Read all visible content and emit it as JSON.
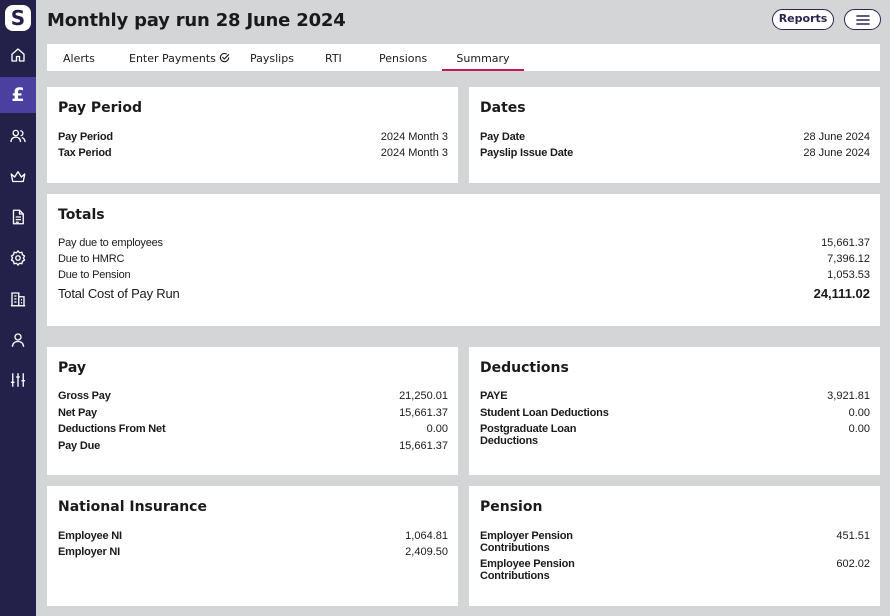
{
  "app": {
    "logo_letter": "S"
  },
  "header": {
    "title": "Monthly pay run 28 June 2024",
    "reports_label": "Reports"
  },
  "tabs": [
    {
      "label": "Alerts"
    },
    {
      "label": "Enter Payments"
    },
    {
      "label": "Payslips"
    },
    {
      "label": "RTI"
    },
    {
      "label": "Pensions"
    },
    {
      "label": "Summary",
      "active": true
    }
  ],
  "sidebar": {
    "items": [
      "home-icon",
      "pound-icon",
      "users-icon",
      "crown-icon",
      "document-icon",
      "gear-icon",
      "building-icon",
      "person-icon",
      "sliders-icon"
    ],
    "active": "pound-icon",
    "pound_glyph": "£"
  },
  "pay_period": {
    "title": "Pay Period",
    "rows": [
      {
        "label": "Pay Period",
        "value": "2024 Month 3"
      },
      {
        "label": "Tax Period",
        "value": "2024 Month 3"
      }
    ]
  },
  "dates": {
    "title": "Dates",
    "rows": [
      {
        "label": "Pay Date",
        "value": "28 June 2024"
      },
      {
        "label": "Payslip Issue Date",
        "value": "28 June 2024"
      }
    ]
  },
  "totals": {
    "title": "Totals",
    "rows": [
      {
        "label": "Pay due to employees",
        "value": "15,661.37"
      },
      {
        "label": "Due to HMRC",
        "value": "7,396.12"
      },
      {
        "label": "Due to Pension",
        "value": "1,053.53"
      },
      {
        "label": "Total Cost of Pay Run",
        "value": "24,111.02"
      }
    ]
  },
  "pay": {
    "title": "Pay",
    "rows": [
      {
        "label": "Gross Pay",
        "value": "21,250.01"
      },
      {
        "label": "Net Pay",
        "value": "15,661.37"
      },
      {
        "label": "Deductions From Net",
        "value": "0.00"
      },
      {
        "label": "Pay Due",
        "value": "15,661.37"
      }
    ]
  },
  "deductions": {
    "title": "Deductions",
    "rows": [
      {
        "label": "PAYE",
        "value": "3,921.81"
      },
      {
        "label": "Student Loan Deductions",
        "value": "0.00"
      },
      {
        "label": "Postgraduate Loan Deductions",
        "value": "0.00"
      }
    ]
  },
  "national_insurance": {
    "title": "National Insurance",
    "rows": [
      {
        "label": "Employee NI",
        "value": "1,064.81"
      },
      {
        "label": "Employer NI",
        "value": "2,409.50"
      }
    ]
  },
  "pension": {
    "title": "Pension",
    "rows": [
      {
        "label": "Employer Pension Contributions",
        "value": "451.51"
      },
      {
        "label": "Employee Pension Contributions",
        "value": "602.02"
      }
    ]
  },
  "colors": {
    "sidebar_bg": "#23204a",
    "sidebar_active": "#4b3fa0",
    "tab_active_underline": "#c2185b",
    "page_bg": "#d4d5d6"
  }
}
